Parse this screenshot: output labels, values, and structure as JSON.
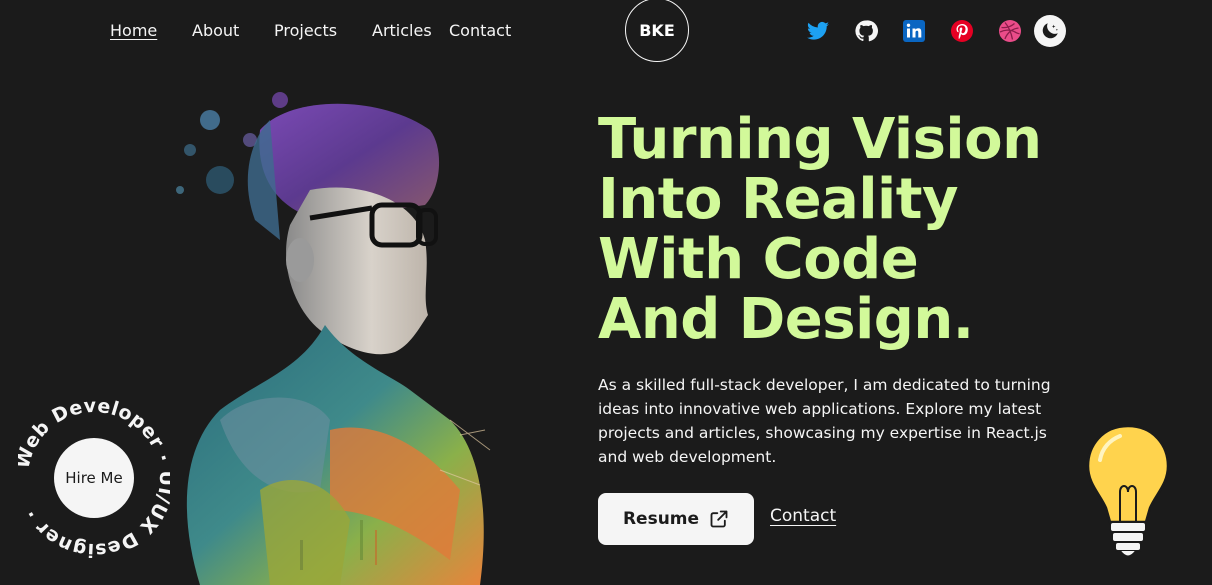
{
  "nav": {
    "links": [
      "Home",
      "About",
      "Projects",
      "Articles",
      "Contact"
    ],
    "active": "Home",
    "logo": "BKE"
  },
  "social": [
    {
      "name": "twitter-icon",
      "color": "#1DA1F2"
    },
    {
      "name": "github-icon",
      "color": "#f5f5f5"
    },
    {
      "name": "linkedin-icon",
      "color": "#0A66C2"
    },
    {
      "name": "pinterest-icon",
      "color": "#E60023"
    },
    {
      "name": "dribbble-icon",
      "color": "#EA4C89"
    }
  ],
  "theme_toggle_icon": "moon-icon",
  "hero": {
    "title_lines": [
      "Turning Vision",
      "Into Reality",
      "With Code",
      "And Design."
    ],
    "description": "As a skilled full-stack developer, I am dedicated to turning ideas into innovative web applications. Explore my latest projects and articles, showcasing my expertise in React.js and web development.",
    "resume_label": "Resume",
    "contact_label": "Contact"
  },
  "hire": {
    "label": "Hire Me",
    "ring_text": "Web Developer · UI/UX Designer · "
  },
  "colors": {
    "background": "#1b1b1b",
    "accent": "#d2f99a",
    "light": "#f5f5f5"
  }
}
